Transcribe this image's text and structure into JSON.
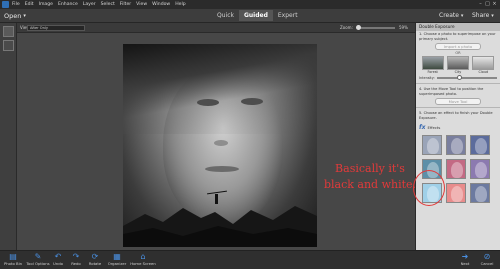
{
  "menubar": {
    "items": [
      "File",
      "Edit",
      "Image",
      "Enhance",
      "Layer",
      "Select",
      "Filter",
      "View",
      "Window",
      "Help"
    ]
  },
  "modebar": {
    "open_label": "Open",
    "tabs": [
      "Quick",
      "Guided",
      "Expert"
    ],
    "active_tab": "Guided",
    "create_label": "Create",
    "share_label": "Share"
  },
  "optbar": {
    "view_label": "View:",
    "view_value": "After Only",
    "zoom_label": "Zoom:",
    "zoom_value": "59%"
  },
  "panel": {
    "title": "Double Exposure",
    "step1": "1. Choose a photo to superimpose on your primary subject.",
    "import_button": "Import a photo",
    "or_label": "OR",
    "presets": [
      "Forest",
      "City",
      "Cloud"
    ],
    "intensity_label": "Intensity:",
    "step4": "4. Use the Move Tool to position the superimposed photo.",
    "move_tool_button": "Move Tool",
    "step5": "5. Choose an effect to finish your Double Exposure.",
    "effects_label": "Effects",
    "effect_colors": [
      "#9aa4b8",
      "#7a7f9e",
      "#5c6c9c",
      "#5c8fa8",
      "#c36a84",
      "#8c7ab0",
      "#a0d0e8",
      "#e88c8c",
      "#6c7aa0"
    ]
  },
  "annotation": {
    "text": "Basically it's black and white."
  },
  "bottombar": {
    "items": [
      {
        "label": "Photo Bin",
        "icon": "photo-bin-icon"
      },
      {
        "label": "Tool Options",
        "icon": "tool-options-icon"
      },
      {
        "label": "Undo",
        "icon": "undo-icon"
      },
      {
        "label": "Redo",
        "icon": "redo-icon"
      },
      {
        "label": "Rotate",
        "icon": "rotate-icon"
      },
      {
        "label": "Organizer",
        "icon": "organizer-icon"
      },
      {
        "label": "Home Screen",
        "icon": "home-screen-icon"
      },
      {
        "label": "Next",
        "icon": "next-icon"
      },
      {
        "label": "Cancel",
        "icon": "cancel-icon"
      }
    ]
  }
}
